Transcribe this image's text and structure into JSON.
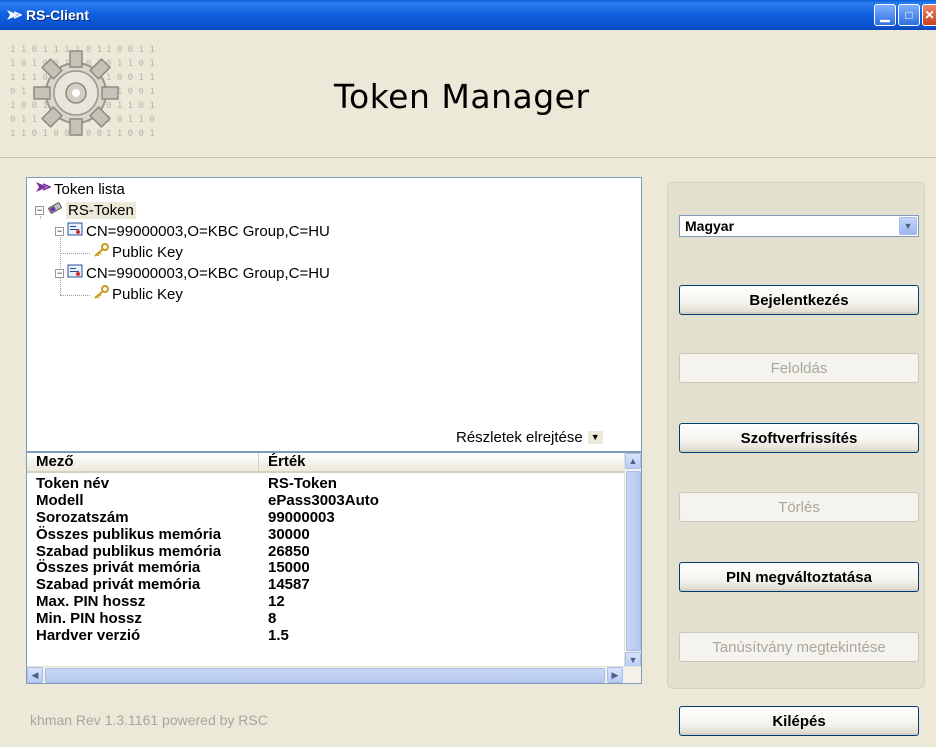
{
  "window": {
    "title": "RS-Client",
    "minimize_glyph": "▁",
    "maximize_glyph": "□",
    "close_glyph": "✕"
  },
  "header": {
    "title": "Token Manager"
  },
  "tree": {
    "root_label": "Token lista",
    "token_label": "RS-Token",
    "cert1_label": "CN=99000003,O=KBC Group,C=HU",
    "cert1_key_label": "Public Key",
    "cert2_label": "CN=99000003,O=KBC Group,C=HU",
    "cert2_key_label": "Public Key"
  },
  "details": {
    "toggle_label": "Részletek elrejtése",
    "col_field": "Mező",
    "col_value": "Érték",
    "rows": [
      {
        "field": "Token név",
        "value": "RS-Token"
      },
      {
        "field": "Modell",
        "value": "ePass3003Auto"
      },
      {
        "field": "Sorozatszám",
        "value": "99000003"
      },
      {
        "field": "Összes publikus memória",
        "value": "30000"
      },
      {
        "field": "Szabad publikus memória",
        "value": "26850"
      },
      {
        "field": "Összes privát memória",
        "value": "15000"
      },
      {
        "field": "Szabad privát memória",
        "value": "14587"
      },
      {
        "field": "Max. PIN hossz",
        "value": "12"
      },
      {
        "field": "Min. PIN hossz",
        "value": "8"
      },
      {
        "field": "Hardver verzió",
        "value": "1.5"
      }
    ]
  },
  "language": {
    "selected": "Magyar"
  },
  "buttons": {
    "login": "Bejelentkezés",
    "unlock": "Feloldás",
    "update": "Szoftverfrissítés",
    "delete": "Törlés",
    "change_pin": "PIN megváltoztatása",
    "view_cert": "Tanúsítvány megtekintése",
    "exit": "Kilépés"
  },
  "footer": {
    "version": "khman Rev 1.3.1161 powered by RSC"
  },
  "colors": {
    "titlebar": "#0b51cc",
    "background": "#ece9d8",
    "disabled_text": "#a9a69a",
    "button_border": "#003c74"
  }
}
